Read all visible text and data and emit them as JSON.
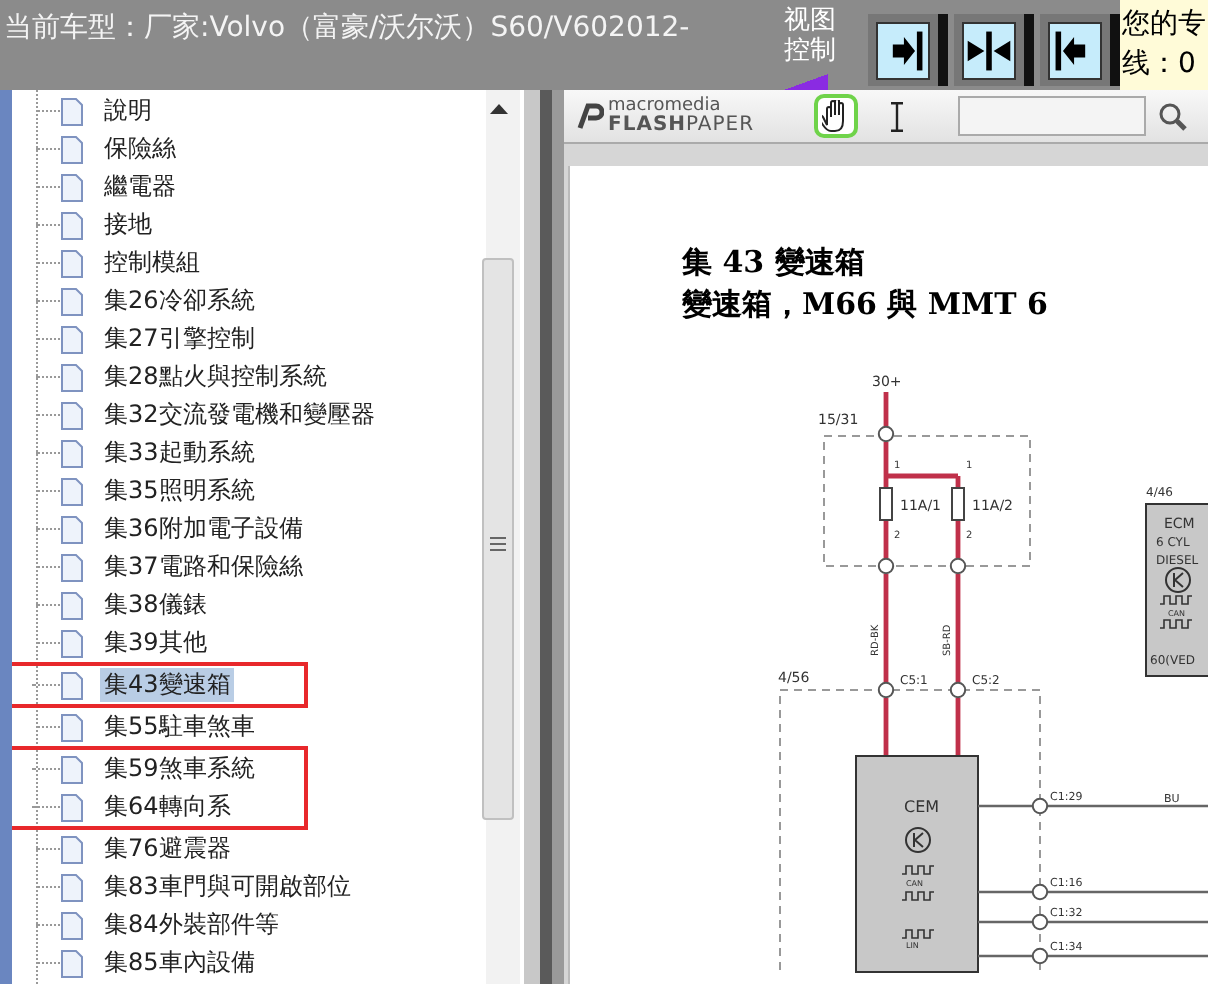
{
  "header": {
    "title": "当前车型：厂家:Volvo（富豪/沃尔沃）S60/V602012-",
    "view_control": [
      "视图",
      "控制"
    ],
    "view_buttons": [
      {
        "kind": "right"
      },
      {
        "kind": "both"
      },
      {
        "kind": "left"
      }
    ],
    "notice": [
      "您的专",
      "线：0"
    ]
  },
  "tree": {
    "items": [
      {
        "kind": "item",
        "label": "說明",
        "selected": false
      },
      {
        "kind": "item",
        "label": "保險絲",
        "selected": false
      },
      {
        "kind": "item",
        "label": "繼電器",
        "selected": false
      },
      {
        "kind": "item",
        "label": "接地",
        "selected": false
      },
      {
        "kind": "item",
        "label": "控制模組",
        "selected": false
      },
      {
        "kind": "item",
        "label": "集26冷卻系統",
        "selected": false
      },
      {
        "kind": "item",
        "label": "集27引擎控制",
        "selected": false
      },
      {
        "kind": "item",
        "label": "集28點火與控制系統",
        "selected": false
      },
      {
        "kind": "item",
        "label": "集32交流發電機和變壓器",
        "selected": false
      },
      {
        "kind": "item",
        "label": "集33起動系統",
        "selected": false
      },
      {
        "kind": "item",
        "label": "集35照明系統",
        "selected": false
      },
      {
        "kind": "item",
        "label": "集36附加電子設備",
        "selected": false
      },
      {
        "kind": "item",
        "label": "集37電路和保險絲",
        "selected": false
      },
      {
        "kind": "item",
        "label": "集38儀錶",
        "selected": false
      },
      {
        "kind": "item",
        "label": "集39其他",
        "selected": false
      },
      {
        "kind": "callout",
        "color": "#e8282b",
        "items": [
          {
            "kind": "item",
            "label": "集43變速箱",
            "selected": true
          }
        ]
      },
      {
        "kind": "item",
        "label": "集55駐車煞車",
        "selected": false
      },
      {
        "kind": "callout",
        "color": "#e8282b",
        "items": [
          {
            "kind": "item",
            "label": "集59煞車系統",
            "selected": false
          },
          {
            "kind": "item",
            "label": "集64轉向系",
            "selected": false
          }
        ]
      },
      {
        "kind": "item",
        "label": "集76避震器",
        "selected": false
      },
      {
        "kind": "item",
        "label": "集83車門與可開啟部位",
        "selected": false
      },
      {
        "kind": "item",
        "label": "集84外裝部件等",
        "selected": false
      },
      {
        "kind": "item",
        "label": "集85車內設備",
        "selected": false
      }
    ]
  },
  "viewer": {
    "logo_top": "macromedia",
    "logo_bold": "FLASH",
    "logo_light": "PAPER",
    "tools": [
      {
        "kind": "hand",
        "selected": true
      },
      {
        "kind": "text",
        "selected": false
      }
    ],
    "document": {
      "heading": "集 43 變速箱",
      "subheading": "變速箱，M66 與 MMT 6",
      "diagram": {
        "supply": "30+",
        "fuse_box": "15/31",
        "fuses": [
          {
            "label": "11A/1",
            "pin_in": "1",
            "pin_out": "2"
          },
          {
            "label": "11A/2",
            "pin_in": "1",
            "pin_out": "2"
          }
        ],
        "wires": [
          "RD-BK",
          "SB-RD"
        ],
        "cem": {
          "ref": "4/56",
          "connectors": [
            "C5:1",
            "C5:2"
          ],
          "name": "CEM",
          "bus_labels": [
            "CAN",
            "LIN"
          ],
          "outputs": [
            {
              "pin": "C1:29",
              "wire": "BU"
            },
            {
              "pin": "C1:16"
            },
            {
              "pin": "C1:32"
            },
            {
              "pin": "C1:34"
            }
          ]
        },
        "ecm": {
          "ref": "4/46",
          "lines": [
            "ECM",
            "6 CYL",
            "DIESEL"
          ],
          "bus_label": "CAN",
          "footer": "60(VED"
        }
      }
    }
  }
}
